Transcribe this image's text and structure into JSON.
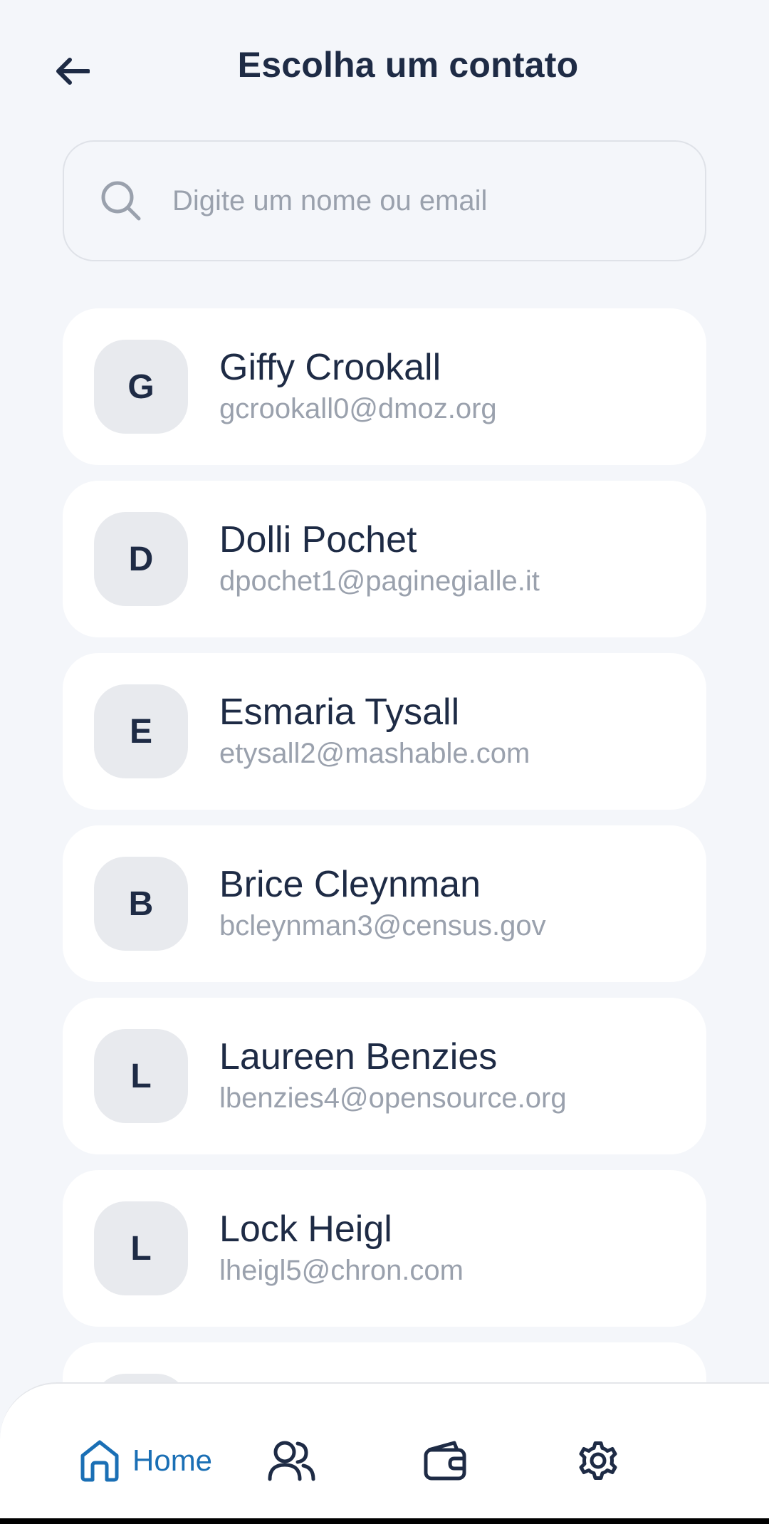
{
  "header": {
    "title": "Escolha um contato",
    "back_icon": "arrow-left-icon"
  },
  "search": {
    "placeholder": "Digite um nome ou email",
    "value": "",
    "icon": "search-icon"
  },
  "contacts": [
    {
      "initial": "G",
      "name": "Giffy Crookall",
      "email": "gcrookall0@dmoz.org"
    },
    {
      "initial": "D",
      "name": "Dolli Pochet",
      "email": "dpochet1@paginegialle.it"
    },
    {
      "initial": "E",
      "name": "Esmaria Tysall",
      "email": "etysall2@mashable.com"
    },
    {
      "initial": "B",
      "name": "Brice Cleynman",
      "email": "bcleynman3@census.gov"
    },
    {
      "initial": "L",
      "name": "Laureen Benzies",
      "email": "lbenzies4@opensource.org"
    },
    {
      "initial": "L",
      "name": "Lock Heigl",
      "email": "lheigl5@chron.com"
    },
    {
      "initial": "",
      "name": "",
      "email": ""
    }
  ],
  "bottom_nav": {
    "home_label": "Home",
    "items": [
      "home-icon",
      "users-icon",
      "wallet-icon",
      "settings-icon"
    ],
    "active": "home"
  },
  "colors": {
    "background": "#f4f6fa",
    "text": "#1e2b45",
    "muted": "#9aa1ad",
    "accent": "#1a6fb5",
    "card": "#ffffff",
    "avatar": "#e8eaee"
  }
}
